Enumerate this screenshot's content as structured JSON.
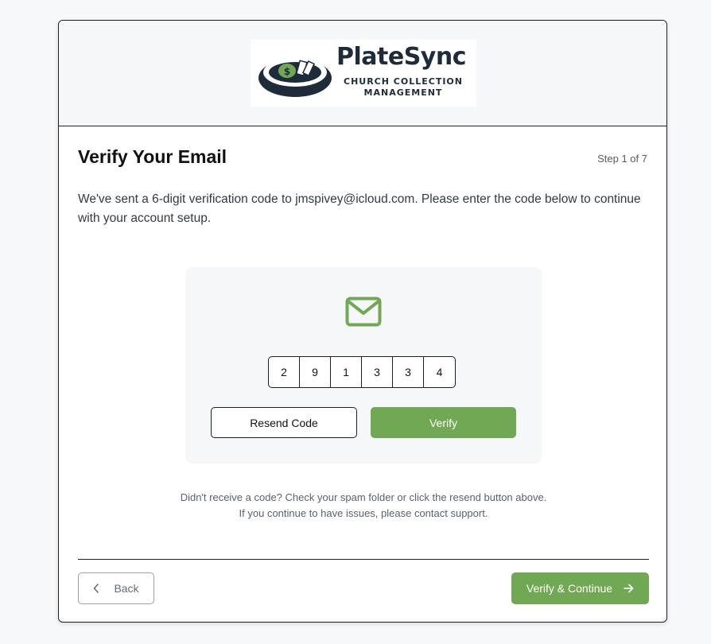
{
  "brand": {
    "name": "PlateSync",
    "tagline_line1": "CHURCH COLLECTION",
    "tagline_line2": "MANAGEMENT"
  },
  "page": {
    "title": "Verify Your Email",
    "step": "Step 1 of 7",
    "intro": "We've sent a 6-digit verification code to jmspivey@icloud.com. Please enter the code below to continue with your account setup."
  },
  "verification": {
    "icon": "mail-icon",
    "digits": [
      "2",
      "9",
      "1",
      "3",
      "3",
      "4"
    ],
    "resend_label": "Resend Code",
    "verify_label": "Verify"
  },
  "help_text": "Didn't receive a code? Check your spam folder or click the resend button above. If you continue to have issues, please contact support.",
  "footer": {
    "back_label": "Back",
    "next_label": "Verify & Continue"
  },
  "colors": {
    "accent": "#71a854",
    "brand_dark": "#1e2b3a"
  }
}
